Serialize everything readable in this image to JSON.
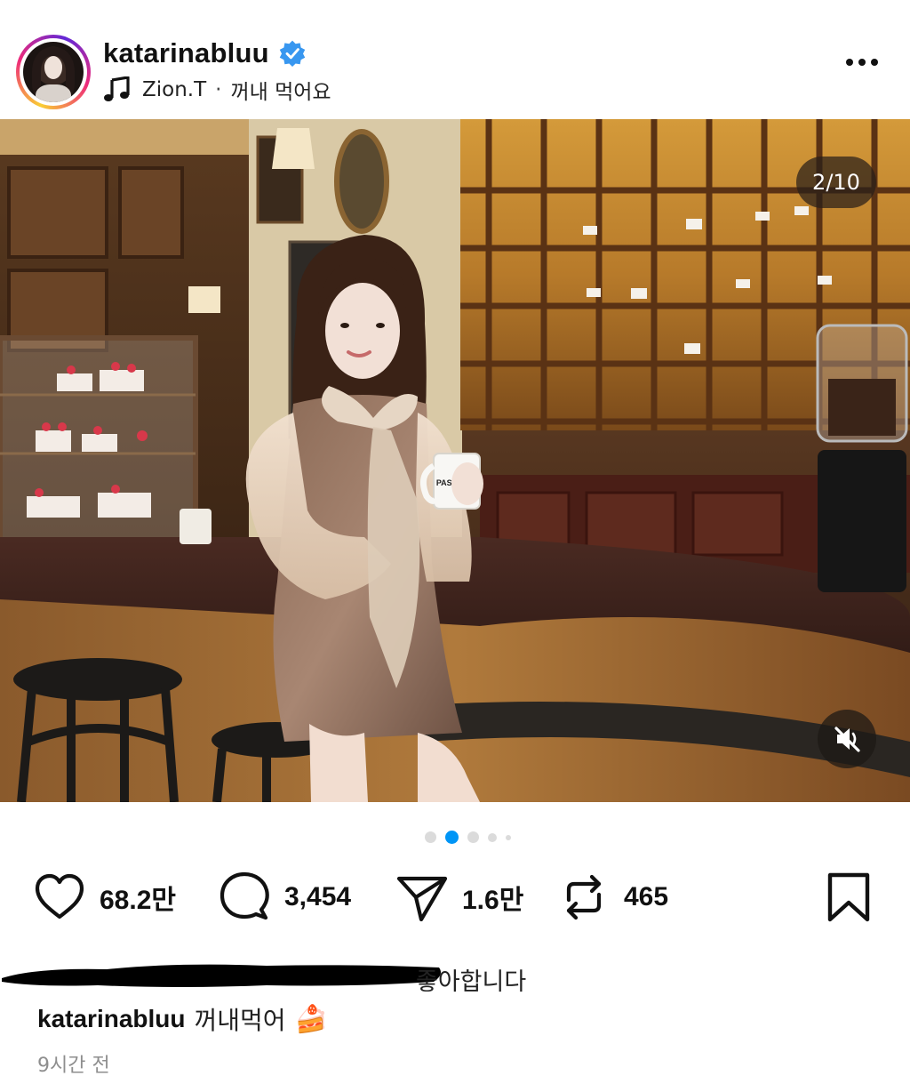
{
  "post": {
    "username": "katarinabluu",
    "music_artist": "Zion.T",
    "music_separator": "·",
    "music_title": "꺼내 먹어요",
    "image_counter": "2/10",
    "image_alt_text": "PASCUCCI",
    "likes_count": "68.2만",
    "comments_count": "3,454",
    "shares_count": "1.6만",
    "reposts_count": "465",
    "liked_by_text": "좋아합니다",
    "caption_username": "katarinabluu",
    "caption_text": "꺼내먹어",
    "caption_emoji": "🍰",
    "timestamp": "9시간 전"
  },
  "carousel": {
    "total_dots": 5,
    "active_index": 1
  },
  "colors": {
    "verified": "#3897f0",
    "active_dot": "#0095f6",
    "inactive_dot": "#dbdbdb"
  }
}
